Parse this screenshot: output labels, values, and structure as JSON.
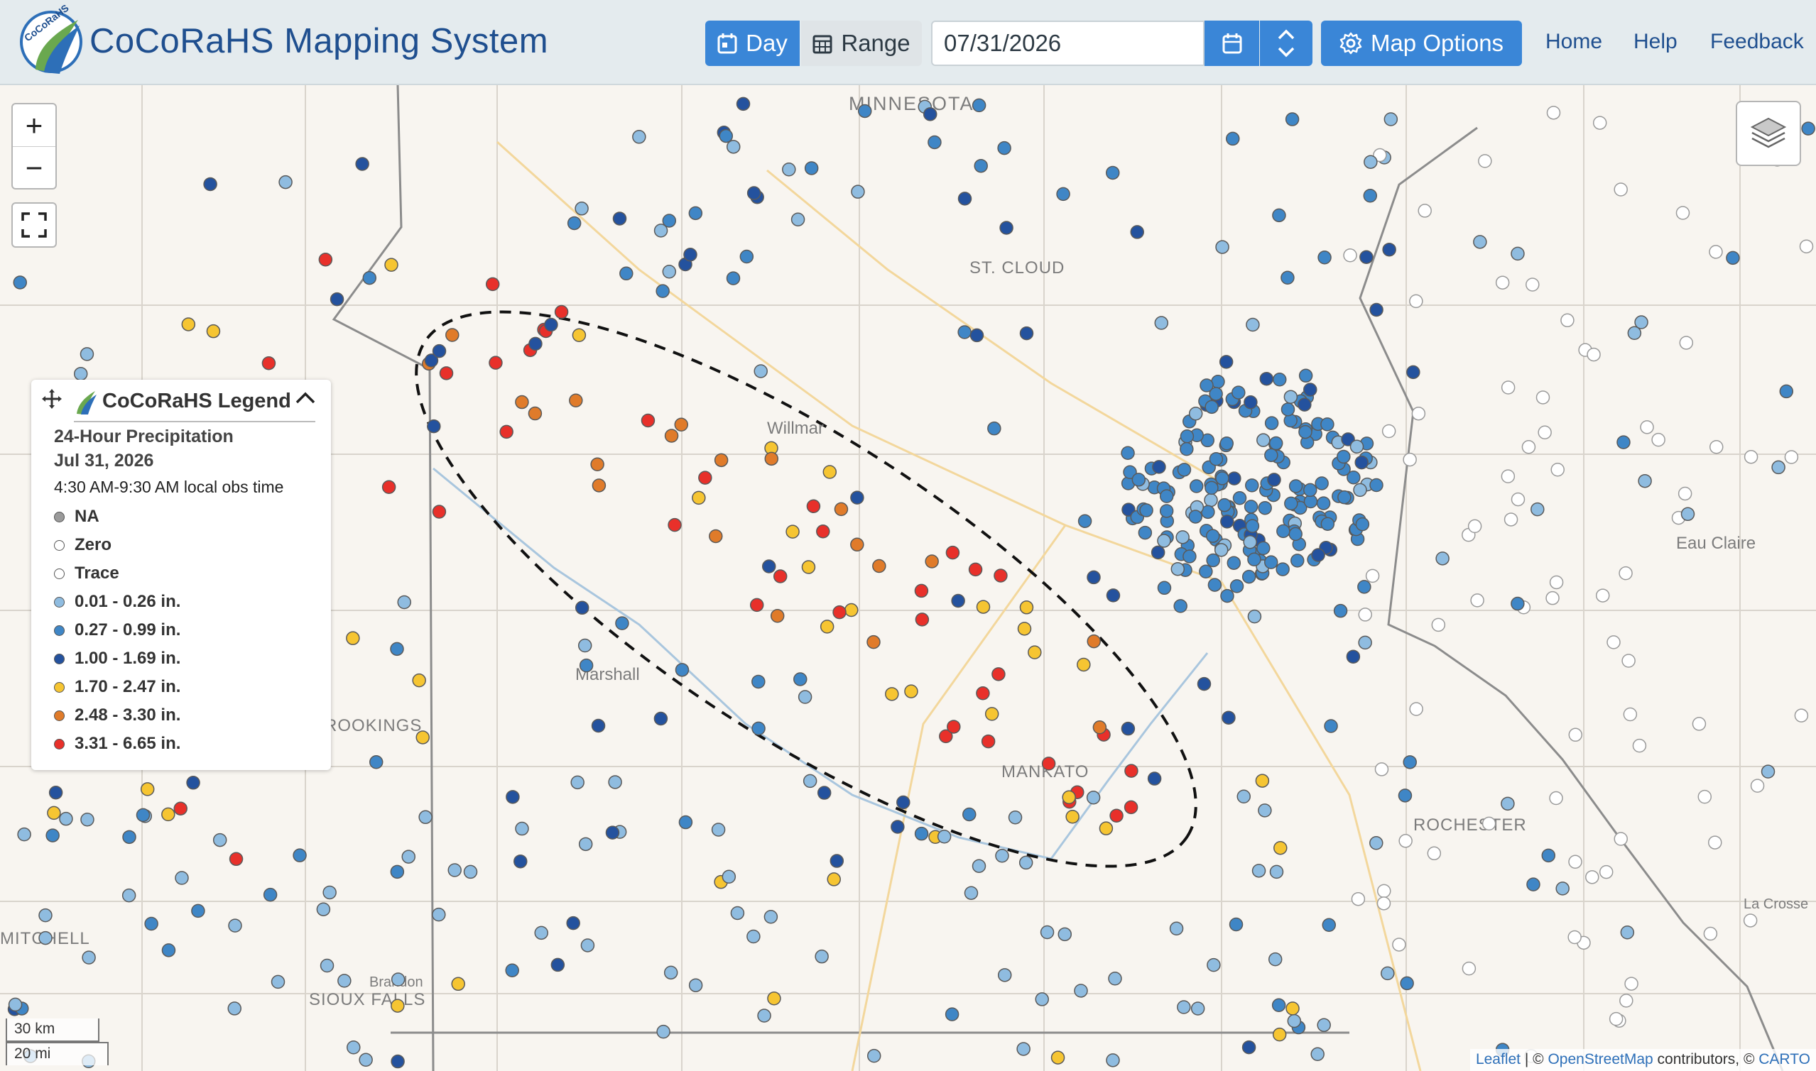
{
  "header": {
    "title": "CoCoRaHS Mapping System",
    "logo_text": "CoCoRaHS",
    "btn_day": "Day",
    "btn_range": "Range",
    "date_value": "07/31/2026",
    "btn_map_options": "Map Options",
    "nav": {
      "home": "Home",
      "help": "Help",
      "feedback": "Feedback"
    }
  },
  "map_controls": {
    "zoom_in": "+",
    "zoom_out": "−"
  },
  "legend": {
    "title": "CoCoRaHS Legend",
    "subtitle": "24-Hour Precipitation",
    "date": "Jul 31, 2026",
    "obs_time": "4:30 AM-9:30 AM local obs time",
    "items": [
      {
        "label": "NA",
        "color": "#9a9a9a"
      },
      {
        "label": "Zero",
        "color": "#ffffff"
      },
      {
        "label": "Trace",
        "color": "#ffffff"
      },
      {
        "label": "0.01 - 0.26 in.",
        "color": "#8fbce0"
      },
      {
        "label": "0.27 - 0.99 in.",
        "color": "#3f86c6"
      },
      {
        "label": "1.00 - 1.69 in.",
        "color": "#24529e"
      },
      {
        "label": "1.70 - 2.47 in.",
        "color": "#f6c532"
      },
      {
        "label": "2.48 - 3.30 in.",
        "color": "#e07b2a"
      },
      {
        "label": "3.31 - 6.65 in.",
        "color": "#e8302a"
      }
    ]
  },
  "map_labels": {
    "minnesota": "MINNESOTA",
    "st_cloud": "ST. CLOUD",
    "willmar": "Willmar",
    "marshall": "Marshall",
    "brookings": "BROOKINGS",
    "brandon": "Brandon",
    "sioux_falls": "SIOUX FALLS",
    "mitchell": "MITCHELL",
    "eau_claire": "Eau Claire",
    "rochester": "ROCHESTER",
    "la_crosse": "La Crosse",
    "mankato": "MANKATO"
  },
  "scale": {
    "km": "30 km",
    "mi": "20 mi"
  },
  "attribution": {
    "leaflet": "Leaflet",
    "osm": "OpenStreetMap",
    "contributors": " contributors, © ",
    "carto": "CARTO",
    "sep": " | © "
  }
}
